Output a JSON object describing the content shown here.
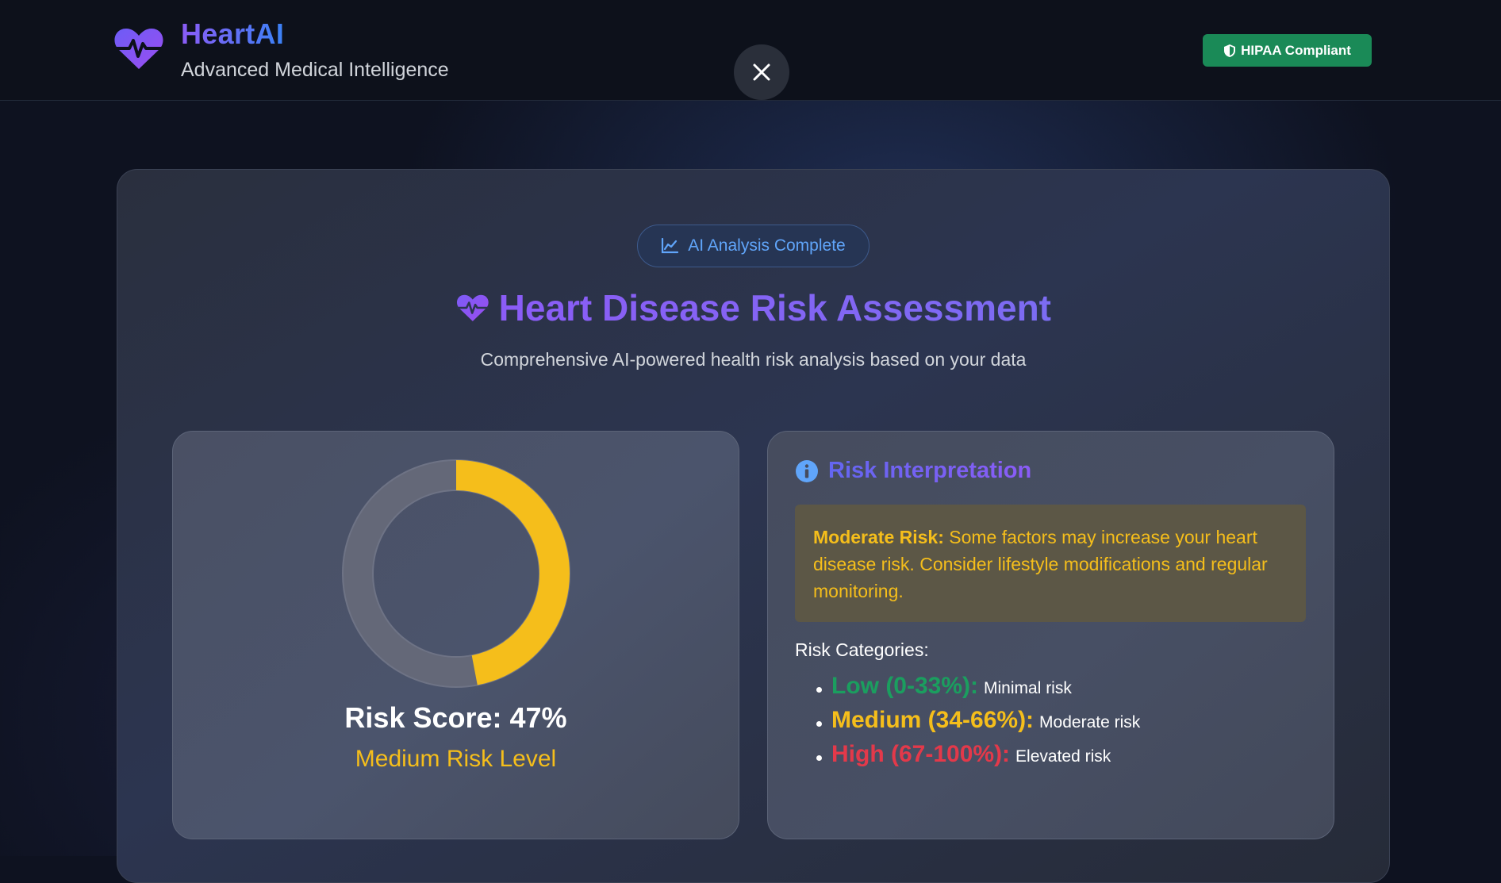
{
  "app": {
    "name": "HeartAI",
    "tagline": "Advanced Medical Intelligence",
    "compliance_badge": "HIPAA Compliant",
    "brand_icon": "heart-pulse-icon",
    "close_icon": "close-icon",
    "badge_icon": "shield-icon"
  },
  "main": {
    "status_pill": "AI Analysis Complete",
    "status_icon": "chart-line-icon",
    "title": "Heart Disease Risk Assessment",
    "title_icon": "heart-pulse-icon",
    "subtitle": "Comprehensive AI-powered health risk analysis based on your data"
  },
  "score": {
    "label": "Risk Score: 47%",
    "value": 47,
    "max": 100,
    "level": "Medium Risk Level",
    "gauge_color": "#f5be1b",
    "track_color": "#646878"
  },
  "interpretation": {
    "title": "Risk Interpretation",
    "title_icon": "info-icon",
    "alert_strong": "Moderate Risk:",
    "alert_text": " Some factors may increase your heart disease risk. Consider lifestyle modifications and regular monitoring.",
    "categories_heading": "Risk Categories:",
    "categories": [
      {
        "range": "Low (0-33%):",
        "desc": "Minimal risk",
        "color": "#1b9e5f"
      },
      {
        "range": "Medium (34-66%):",
        "desc": "Moderate risk",
        "color": "#f5be1b"
      },
      {
        "range": "High (67-100%):",
        "desc": "Elevated risk",
        "color": "#e3394a"
      }
    ]
  },
  "colors": {
    "accent_purple": "#8b5cf6",
    "accent_blue": "#3b82f6",
    "success_green": "#1a8a57",
    "warning_yellow": "#f5be1b",
    "danger_red": "#e3394a"
  }
}
